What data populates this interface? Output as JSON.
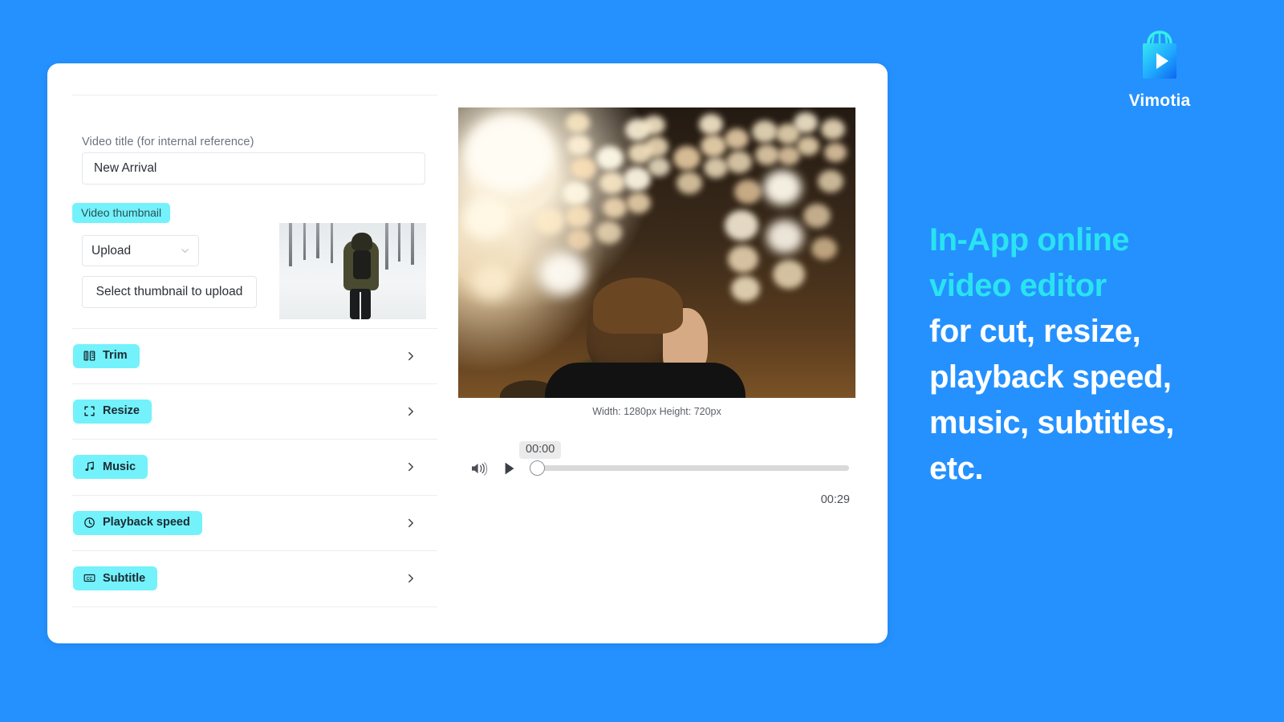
{
  "theme": {
    "page_background": "#2491FF",
    "card_background": "#FFFFFF",
    "accent_cyan": "#73F2FB",
    "headline_accent": "#2AE3F0",
    "text_dark": "#2B2F36",
    "text_muted": "#6B7280"
  },
  "form": {
    "title_label": "Video title (for internal reference)",
    "title_value": "New Arrival",
    "title_placeholder": "New Arrival",
    "thumbnail_badge": "Video thumbnail",
    "upload_select_value": "Upload",
    "upload_select_options": [
      "Upload"
    ],
    "select_thumbnail_button": "Select thumbnail to upload",
    "thumbnail_preview_alt": "person in olive parka with backpack walking in snowy birch forest"
  },
  "features": [
    {
      "label": "Trim",
      "icon": "film-strip-icon",
      "chevron": "chevron-right-icon"
    },
    {
      "label": "Resize",
      "icon": "crop-corners-icon",
      "chevron": "chevron-right-icon"
    },
    {
      "label": "Music",
      "icon": "music-note-icon",
      "chevron": "chevron-right-icon"
    },
    {
      "label": "Playback speed",
      "icon": "clock-icon",
      "chevron": "chevron-right-icon"
    },
    {
      "label": "Subtitle",
      "icon": "closed-caption-icon",
      "chevron": "chevron-right-icon"
    }
  ],
  "player": {
    "video_alt": "back of a young man in dark coat with warm bokeh string lights behind him",
    "dimensions_label": "Width: 1280px Height: 720px",
    "current_time": "00:00",
    "duration": "00:29",
    "progress_percent": 0,
    "volume_icon": "volume-up-icon",
    "play_icon": "play-icon"
  },
  "brand": {
    "logo_icon": "shopping-bag-play-icon",
    "name": "Vimotia"
  },
  "marketing": {
    "headline_lines": [
      {
        "text": "In-App online",
        "style": "accent"
      },
      {
        "text": "video editor",
        "style": "accent"
      },
      {
        "text": "for cut, resize,",
        "style": "plain"
      },
      {
        "text": "playback speed,",
        "style": "plain"
      },
      {
        "text": "music, subtitles,",
        "style": "plain"
      },
      {
        "text": "etc.",
        "style": "plain"
      }
    ]
  }
}
